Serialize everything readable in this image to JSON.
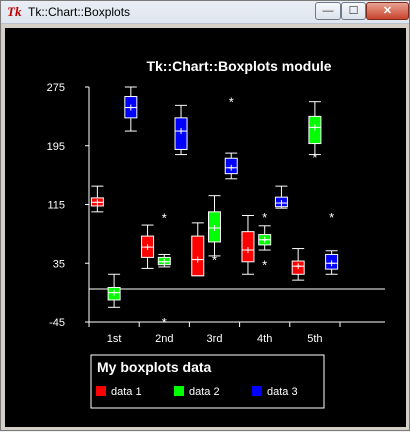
{
  "window": {
    "title": "Tk::Chart::Boxplots",
    "icon_glyph": "Tk",
    "minimize_glyph": "—",
    "maximize_glyph": "☐",
    "close_glyph": "✕"
  },
  "chart_data": {
    "type": "boxplot",
    "title": "Tk::Chart::Boxplots module",
    "xlabel": "",
    "ylabel": "",
    "ylim": [
      -45,
      275
    ],
    "yticks": [
      275,
      195,
      115,
      35,
      -45
    ],
    "xticks": [
      "1st",
      "2nd",
      "3rd",
      "4th",
      "5th"
    ],
    "grid": false,
    "background": "#000000",
    "axis_color": "#ffffff",
    "legend": {
      "title": "My boxplots data",
      "placement": "bottom"
    },
    "series": [
      {
        "name": "data 1",
        "color": "#ff0000",
        "boxes": [
          {
            "whisker_low": 105,
            "q1": 113,
            "median": 118,
            "mean": 118,
            "q3": 124,
            "whisker_high": 140,
            "outliers": []
          },
          {
            "whisker_low": 28,
            "q1": 43,
            "median": 57,
            "mean": 57,
            "q3": 72,
            "whisker_high": 87,
            "outliers": []
          },
          {
            "whisker_low": 18,
            "q1": 18,
            "median": 40,
            "mean": 40,
            "q3": 72,
            "whisker_high": 90,
            "outliers": []
          },
          {
            "whisker_low": 20,
            "q1": 37,
            "median": 53,
            "mean": 53,
            "q3": 78,
            "whisker_high": 100,
            "outliers": []
          },
          {
            "whisker_low": 12,
            "q1": 20,
            "median": 31,
            "mean": 31,
            "q3": 38,
            "whisker_high": 55,
            "outliers": []
          }
        ]
      },
      {
        "name": "data 2",
        "color": "#00ff00",
        "boxes": [
          {
            "whisker_low": -25,
            "q1": -15,
            "median": -5,
            "mean": -5,
            "q3": 2,
            "whisker_high": 20,
            "outliers": []
          },
          {
            "whisker_low": 30,
            "q1": 33,
            "median": 37,
            "mean": 37,
            "q3": 43,
            "whisker_high": 47,
            "outliers": [
              97,
              -45
            ]
          },
          {
            "whisker_low": 45,
            "q1": 64,
            "median": 83,
            "mean": 83,
            "q3": 105,
            "whisker_high": 127,
            "outliers": [
              40
            ]
          },
          {
            "whisker_low": 53,
            "q1": 60,
            "median": 67,
            "mean": 67,
            "q3": 74,
            "whisker_high": 86,
            "outliers": [
              98,
              33
            ]
          },
          {
            "whisker_low": 183,
            "q1": 198,
            "median": 220,
            "mean": 220,
            "q3": 235,
            "whisker_high": 255,
            "outliers": [
              180
            ]
          }
        ]
      },
      {
        "name": "data 3",
        "color": "#0000ff",
        "boxes": [
          {
            "whisker_low": 215,
            "q1": 233,
            "median": 247,
            "mean": 247,
            "q3": 262,
            "whisker_high": 275,
            "outliers": []
          },
          {
            "whisker_low": 183,
            "q1": 190,
            "median": 215,
            "mean": 215,
            "q3": 233,
            "whisker_high": 250,
            "outliers": []
          },
          {
            "whisker_low": 150,
            "q1": 157,
            "median": 165,
            "mean": 165,
            "q3": 178,
            "whisker_high": 185,
            "outliers": [
              255
            ]
          },
          {
            "whisker_low": 110,
            "q1": 112,
            "median": 117,
            "mean": 117,
            "q3": 125,
            "whisker_high": 140,
            "outliers": []
          },
          {
            "whisker_low": 20,
            "q1": 27,
            "median": 35,
            "mean": 35,
            "q3": 47,
            "whisker_high": 52,
            "outliers": [
              98
            ]
          }
        ]
      }
    ]
  }
}
